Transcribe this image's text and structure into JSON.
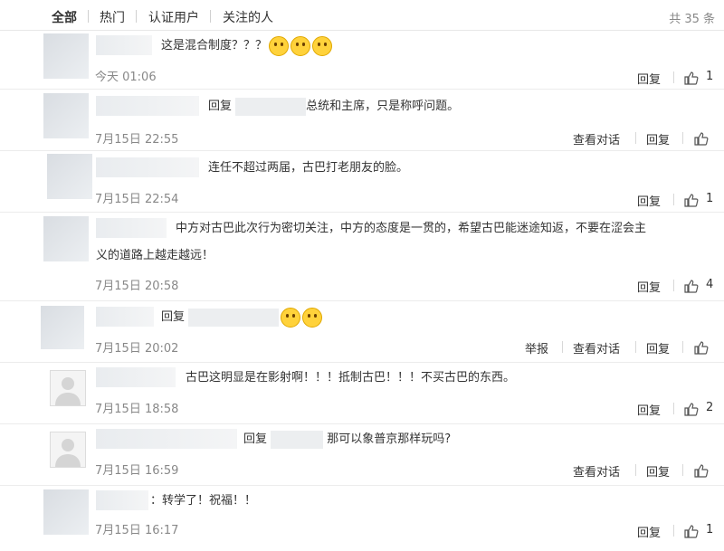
{
  "tabs": [
    {
      "label": "全部"
    },
    {
      "label": "热门"
    },
    {
      "label": "认证用户"
    },
    {
      "label": "关注的人"
    }
  ],
  "total": "共 35 条",
  "icons": {
    "like": "thumbs-up-icon",
    "emoji_smile": "smile-emoji",
    "emoji_cry": "laugh-cry-emoji",
    "avatar_default": "default-avatar-icon"
  },
  "comments": [
    {
      "text": "这是混合制度？？？",
      "time": "今天 01:06",
      "reply": "回复",
      "likes": "1",
      "emoji_count": 3
    },
    {
      "reply_word": "回复",
      "text": "总统和主席，只是称呼问题。",
      "time": "7月15日 22:55",
      "view": "查看对话",
      "reply": "回复"
    },
    {
      "text": "连任不超过两届，古巴打老朋友的脸。",
      "time": "7月15日 22:54",
      "reply": "回复",
      "likes": "1"
    },
    {
      "text": "中方对古巴此次行为密切关注，中方的态度是一贯的，希望古巴能迷途知返，不要在涩会主义的道路上越走越远！",
      "text_line1": "中方对古巴此次行为密切关注，中方的态度是一贯的，希望古巴能迷途知返，不要在涩会主",
      "text_line2": "义的道路上越走越远！",
      "time": "7月15日 20:58",
      "reply": "回复",
      "likes": "4"
    },
    {
      "reply_word": "回复",
      "time": "7月15日 20:02",
      "report": "举报",
      "view": "查看对话",
      "reply": "回复",
      "emoji_count": 2
    },
    {
      "text": "古巴这明显是在影射啊！！！抵制古巴！！！不买古巴的东西。",
      "time": "7月15日 18:58",
      "reply": "回复",
      "likes": "2"
    },
    {
      "reply_word": "回复",
      "text": "那可以象普京那样玩吗?",
      "time": "7月15日 16:59",
      "view": "查看对话",
      "reply": "回复"
    },
    {
      "text": "：转学了！祝福！！",
      "time": "7月15日 16:17",
      "reply": "回复",
      "likes": "1"
    }
  ]
}
